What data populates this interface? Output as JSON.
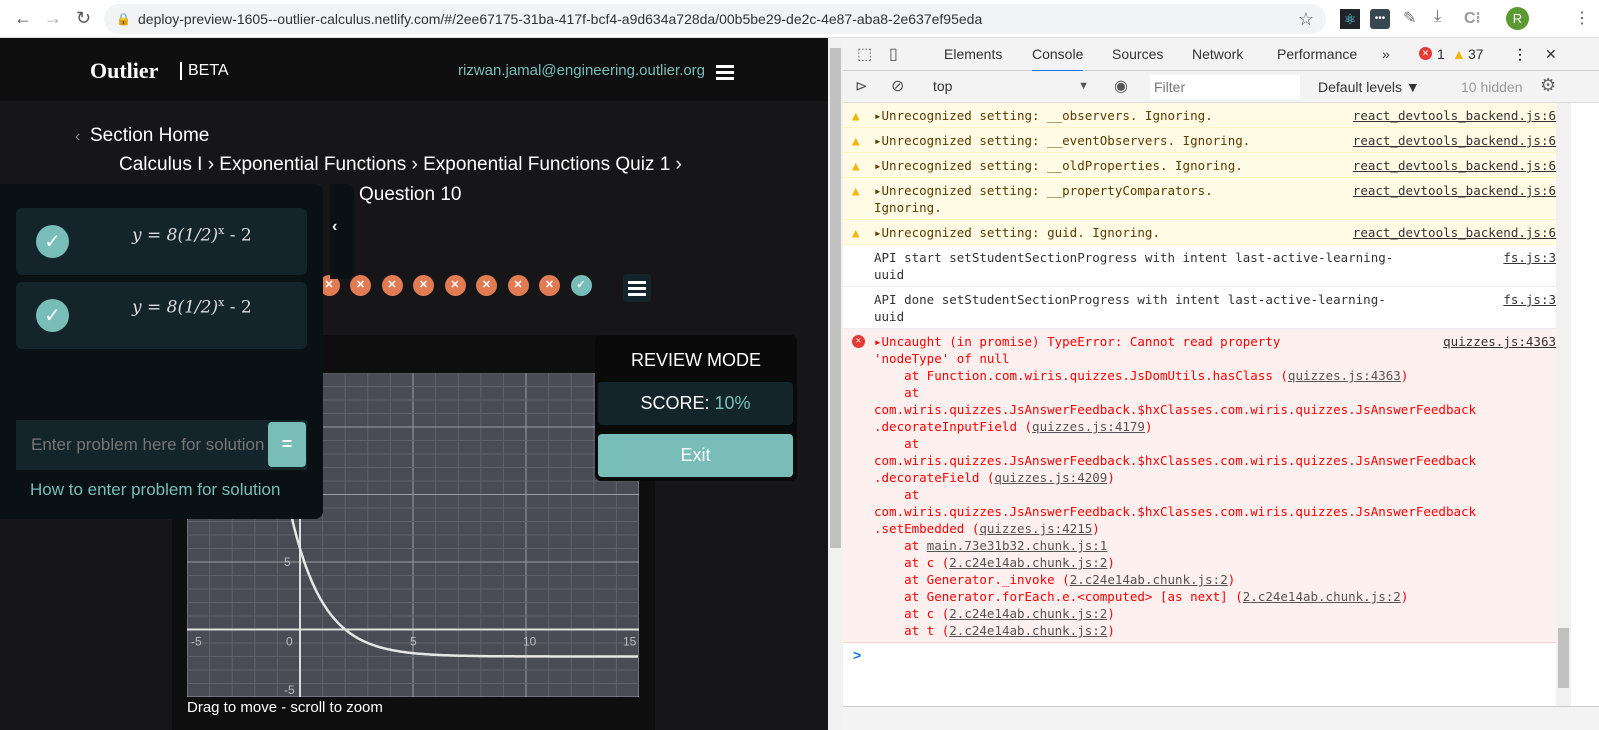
{
  "browser": {
    "url": "deploy-preview-1605--outlier-calculus.netlify.com/#/2ee67175-31ba-417f-bcf4-a9d634a728da/00b5be29-de2c-4e87-aba8-2e637ef95eda",
    "profile_initial": "R"
  },
  "header": {
    "logo": "Outlier",
    "beta": "BETA",
    "email": "rizwan.jamal@engineering.outlier.org"
  },
  "breadcrumb": {
    "back": "Section Home",
    "path": "Calculus I › Exponential Functions › Exponential Functions Quiz 1 ›",
    "current": "Question 10"
  },
  "sidebar": {
    "history": [
      {
        "eq": "y = 8(1/2)",
        "exp": "x",
        "tail": " - 2"
      },
      {
        "eq": "y = 8(1/2)",
        "exp": "x",
        "tail": " - 2"
      }
    ],
    "input_placeholder": "Enter problem here for solution",
    "equals": "=",
    "help_link": "How to enter problem for solution"
  },
  "progress": {
    "statuses": [
      "wrong",
      "wrong",
      "wrong",
      "wrong",
      "wrong",
      "wrong",
      "wrong",
      "wrong",
      "wrong",
      "correct"
    ],
    "colors": {
      "wrong": "#e07b53",
      "correct": "#78bdb8"
    }
  },
  "review": {
    "title": "REVIEW MODE",
    "score_label": "SCORE:",
    "score_value": "10%",
    "exit": "Exit"
  },
  "graph": {
    "caption": "Drag to move - scroll to zoom"
  },
  "chart_data": {
    "type": "line",
    "function": "y = 8(1/2)^x - 2",
    "xlim": [
      -5,
      15
    ],
    "ylim": [
      -5,
      19
    ],
    "x_ticks": [
      "-5",
      "0",
      "5",
      "10",
      "15"
    ],
    "y_ticks": [
      "5",
      "-5"
    ],
    "grid": true
  },
  "devtools": {
    "tabs": [
      "Elements",
      "Console",
      "Sources",
      "Network",
      "Performance",
      "»"
    ],
    "active_tab": "Console",
    "errors": "1",
    "warnings": "37",
    "context": "top",
    "filter_placeholder": "Filter",
    "levels": "Default levels ▼",
    "hidden": "10 hidden",
    "messages": [
      {
        "type": "warn",
        "text": "▸Unrecognized setting: __observers. Ignoring.",
        "src": "react_devtools_backend.js:6"
      },
      {
        "type": "warn",
        "text": "▸Unrecognized setting: __eventObservers. Ignoring.",
        "src": "react_devtools_backend.js:6"
      },
      {
        "type": "warn",
        "text": "▸Unrecognized setting: __oldProperties. Ignoring.",
        "src": "react_devtools_backend.js:6"
      },
      {
        "type": "warn",
        "text": "▸Unrecognized setting: __propertyComparators.\nIgnoring.",
        "src": "react_devtools_backend.js:6"
      },
      {
        "type": "warn",
        "text": "▸Unrecognized setting: guid. Ignoring.",
        "src": "react_devtools_backend.js:6"
      },
      {
        "type": "info",
        "text": "API start setStudentSectionProgress with intent last-active-learning-\nuuid",
        "src": "fs.js:3"
      },
      {
        "type": "info",
        "text": "API done setStudentSectionProgress with intent last-active-learning-\nuuid",
        "src": "fs.js:3"
      }
    ],
    "error": {
      "head": "▸Uncaught (in promise) TypeError: Cannot read property\n'nodeType' of null",
      "src": "quizzes.js:4363",
      "stack": [
        [
          "    at Function.com.wiris.quizzes.JsDomUtils.hasClass (",
          "quizzes.js:4363",
          ")"
        ],
        [
          "    at\ncom.wiris.quizzes.JsAnswerFeedback.$hxClasses.com.wiris.quizzes.JsAnswerFeedback\n.decorateInputField (",
          "quizzes.js:4179",
          ")"
        ],
        [
          "    at\ncom.wiris.quizzes.JsAnswerFeedback.$hxClasses.com.wiris.quizzes.JsAnswerFeedback\n.decorateField (",
          "quizzes.js:4209",
          ")"
        ],
        [
          "    at\ncom.wiris.quizzes.JsAnswerFeedback.$hxClasses.com.wiris.quizzes.JsAnswerFeedback\n.setEmbedded (",
          "quizzes.js:4215",
          ")"
        ],
        [
          "    at ",
          "main.73e31b32.chunk.js:1",
          ""
        ],
        [
          "    at c (",
          "2.c24e14ab.chunk.js:2",
          ")"
        ],
        [
          "    at Generator._invoke (",
          "2.c24e14ab.chunk.js:2",
          ")"
        ],
        [
          "    at Generator.forEach.e.<computed> [as next] (",
          "2.c24e14ab.chunk.js:2",
          ")"
        ],
        [
          "    at c (",
          "2.c24e14ab.chunk.js:2",
          ")"
        ],
        [
          "    at t (",
          "2.c24e14ab.chunk.js:2",
          ")"
        ]
      ]
    },
    "prompt": ">"
  }
}
